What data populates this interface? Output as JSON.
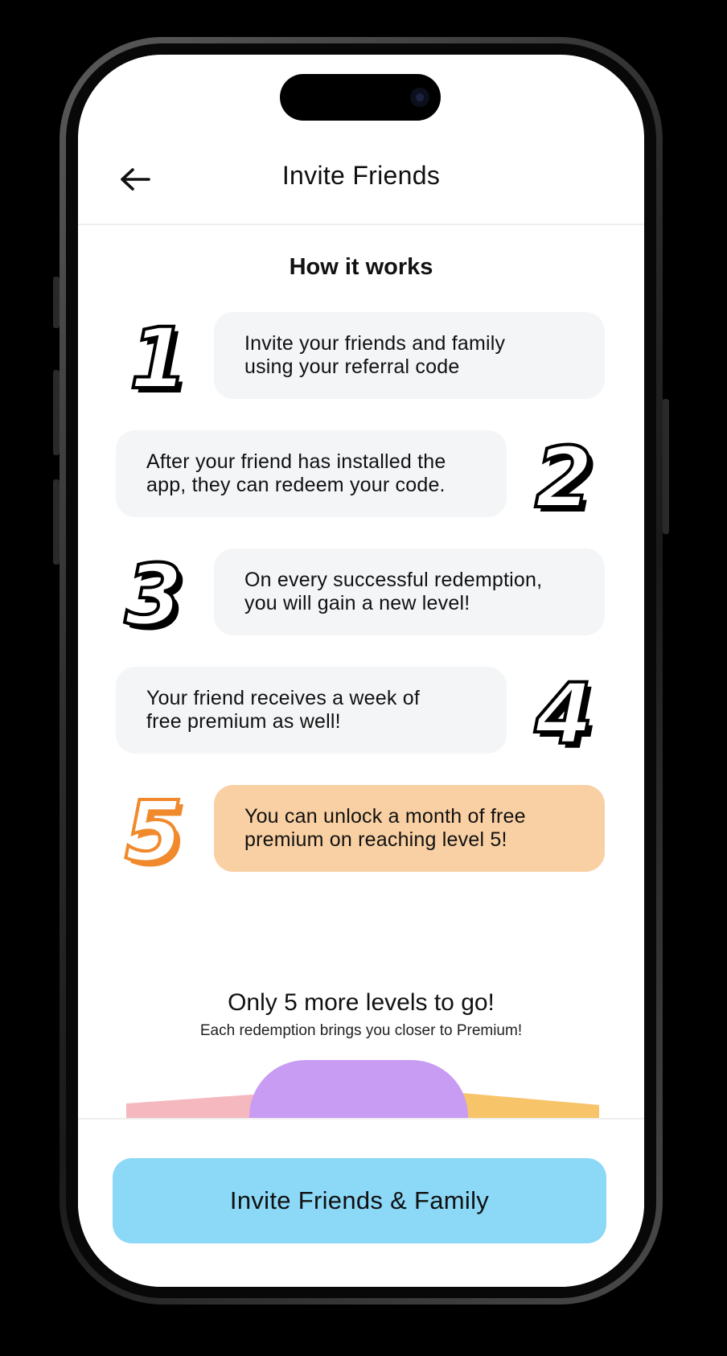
{
  "header": {
    "title": "Invite Friends",
    "back_icon": "arrow-left-icon"
  },
  "how_it_works": {
    "title": "How it works",
    "steps": [
      {
        "number": "1",
        "text_line1": "Invite your friends and family",
        "text_line2": "using your referral code"
      },
      {
        "number": "2",
        "text_line1": "After your friend has installed the",
        "text_line2": "app, they can redeem your code."
      },
      {
        "number": "3",
        "text_line1": "On every successful redemption,",
        "text_line2": "you will gain a new level!"
      },
      {
        "number": "4",
        "text_line1": "Your friend receives a week of",
        "text_line2": "free premium as well!"
      },
      {
        "number": "5",
        "text_line1": "You can unlock a month of free",
        "text_line2": "premium on reaching level 5!"
      }
    ]
  },
  "levels": {
    "title": "Only 5 more levels to go!",
    "subtitle": "Each redemption brings you closer to Premium!"
  },
  "footer": {
    "cta_label": "Invite Friends & Family"
  },
  "colors": {
    "step_box": "#f4f5f7",
    "highlight_box": "#f9d0a3",
    "highlight_number": "#f08a2c",
    "cta": "#8bd8f7",
    "art_purple": "#c99cf3",
    "art_pink": "#f5b8bf",
    "art_orange": "#f7c46a"
  }
}
